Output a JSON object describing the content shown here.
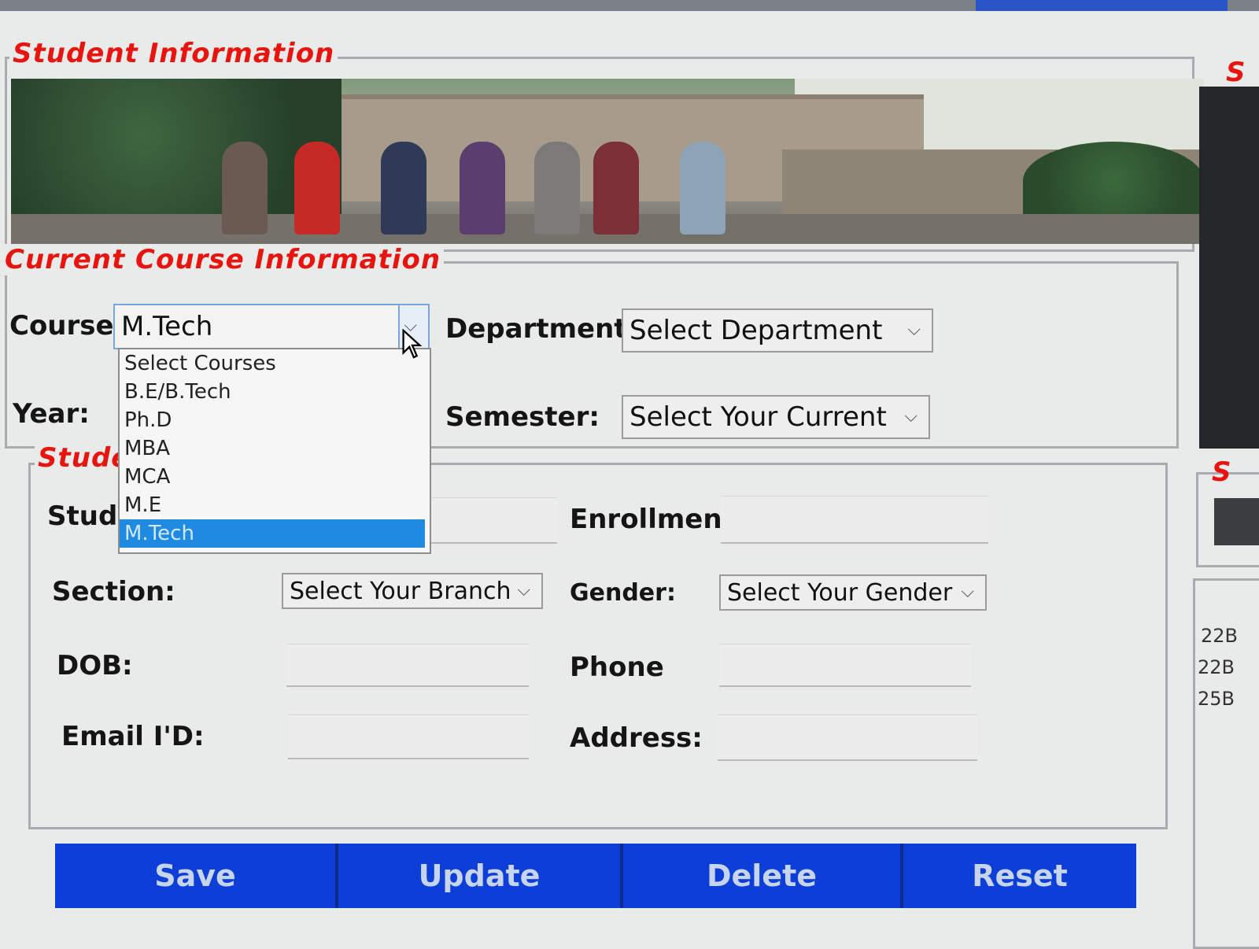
{
  "window": {
    "student_info_title": "Student Information",
    "course_info_title": "Current Course Information",
    "student_details_title": "Stude"
  },
  "course_section": {
    "course_label": "Course",
    "course_value": "M.Tech",
    "department_label": "Department",
    "department_value": "Select Department",
    "year_label": "Year:",
    "semester_label": "Semester:",
    "semester_value": "Select Your Current"
  },
  "course_dropdown": {
    "options": [
      "Select Courses",
      "B.E/B.Tech",
      "Ph.D",
      "MBA",
      "MCA",
      "M.E",
      "M.Tech"
    ],
    "selected": "M.Tech"
  },
  "student_form": {
    "student_label": "Stude",
    "enrollment_label": "Enrollment",
    "section_label": "Section:",
    "section_value": "Select Your Branch",
    "gender_label": "Gender:",
    "gender_value": "Select Your Gender",
    "dob_label": "DOB:",
    "phone_label": "Phone",
    "email_label": "Email I'D:",
    "address_label": "Address:"
  },
  "buttons": {
    "save": "Save",
    "update": "Update",
    "delete": "Delete",
    "reset": "Reset"
  },
  "side_panel": {
    "frag_top": "S",
    "frag_mid": "S",
    "list_items": [
      "22B",
      "22B",
      "25B"
    ]
  },
  "colors": {
    "title_red": "#e8140f",
    "button_blue": "#0d3fd8",
    "selection_blue": "#1f8ae0"
  }
}
